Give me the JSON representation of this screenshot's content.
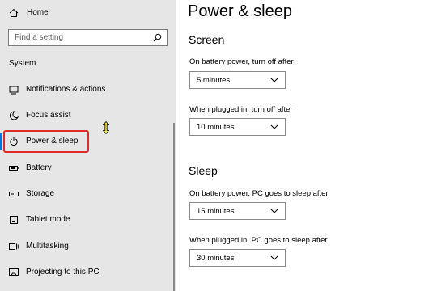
{
  "sidebar": {
    "home_label": "Home",
    "search_placeholder": "Find a setting",
    "section_label": "System",
    "items": [
      {
        "label": "Notifications & actions",
        "icon": "notifications-icon"
      },
      {
        "label": "Focus assist",
        "icon": "moon-icon"
      },
      {
        "label": "Power & sleep",
        "icon": "power-icon"
      },
      {
        "label": "Battery",
        "icon": "battery-icon"
      },
      {
        "label": "Storage",
        "icon": "storage-icon"
      },
      {
        "label": "Tablet mode",
        "icon": "tablet-icon"
      },
      {
        "label": "Multitasking",
        "icon": "multitasking-icon"
      },
      {
        "label": "Projecting to this PC",
        "icon": "projecting-icon"
      }
    ]
  },
  "main": {
    "title": "Power & sleep",
    "screen": {
      "heading": "Screen",
      "battery_label": "On battery power, turn off after",
      "battery_value": "5 minutes",
      "plugged_label": "When plugged in, turn off after",
      "plugged_value": "10 minutes"
    },
    "sleep": {
      "heading": "Sleep",
      "battery_label": "On battery power, PC goes to sleep after",
      "battery_value": "15 minutes",
      "plugged_label": "When plugged in, PC goes to sleep after",
      "plugged_value": "30 minutes"
    }
  },
  "colors": {
    "sidebar_bg": "#e6e6e6",
    "accent": "#0078d7",
    "highlight": "#e02b2b"
  }
}
